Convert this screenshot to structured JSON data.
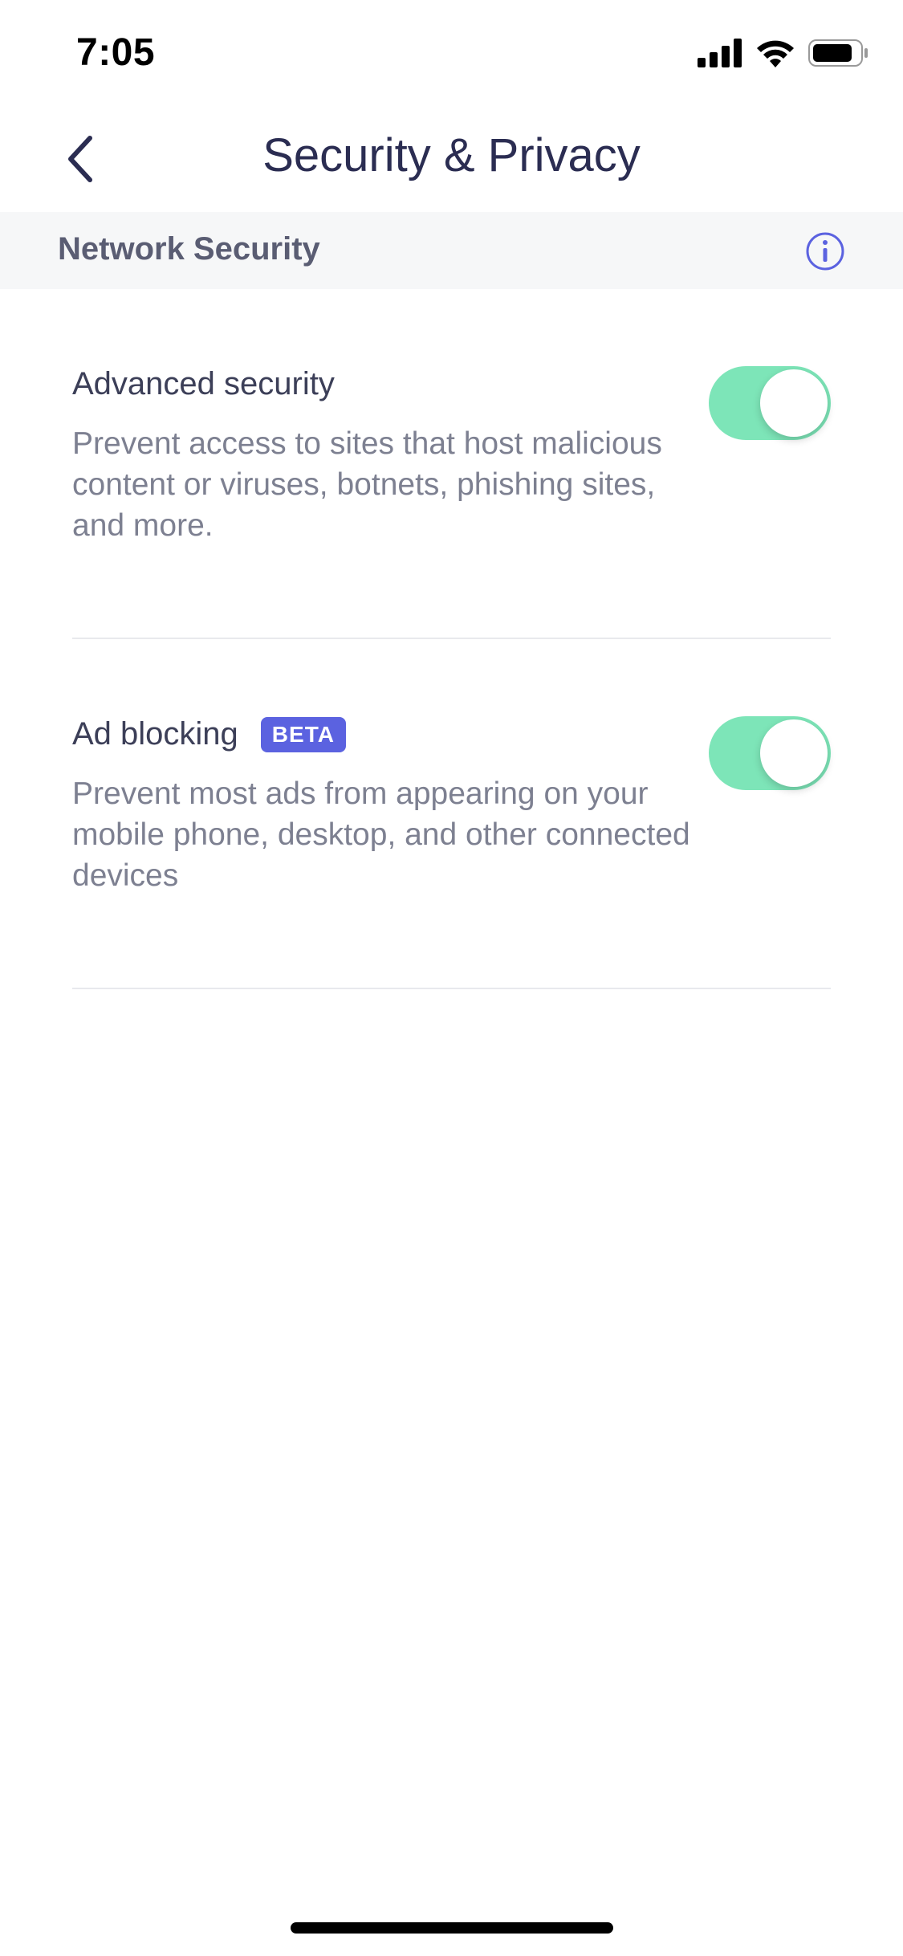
{
  "status_bar": {
    "time": "7:05"
  },
  "nav": {
    "title": "Security & Privacy"
  },
  "section": {
    "title": "Network Security"
  },
  "settings": [
    {
      "title": "Advanced security",
      "description": "Prevent access to sites that host malicious content or viruses, botnets, phishing sites, and more.",
      "enabled": true
    },
    {
      "title": "Ad blocking",
      "badge": "BETA",
      "description": "Prevent most ads from appearing on your mobile phone, desktop, and other connected devices",
      "enabled": true
    }
  ],
  "colors": {
    "toggle_on": "#7de5b8",
    "badge_bg": "#5b62e0",
    "title_text": "#2b2d52",
    "info_icon": "#5b62e0"
  }
}
